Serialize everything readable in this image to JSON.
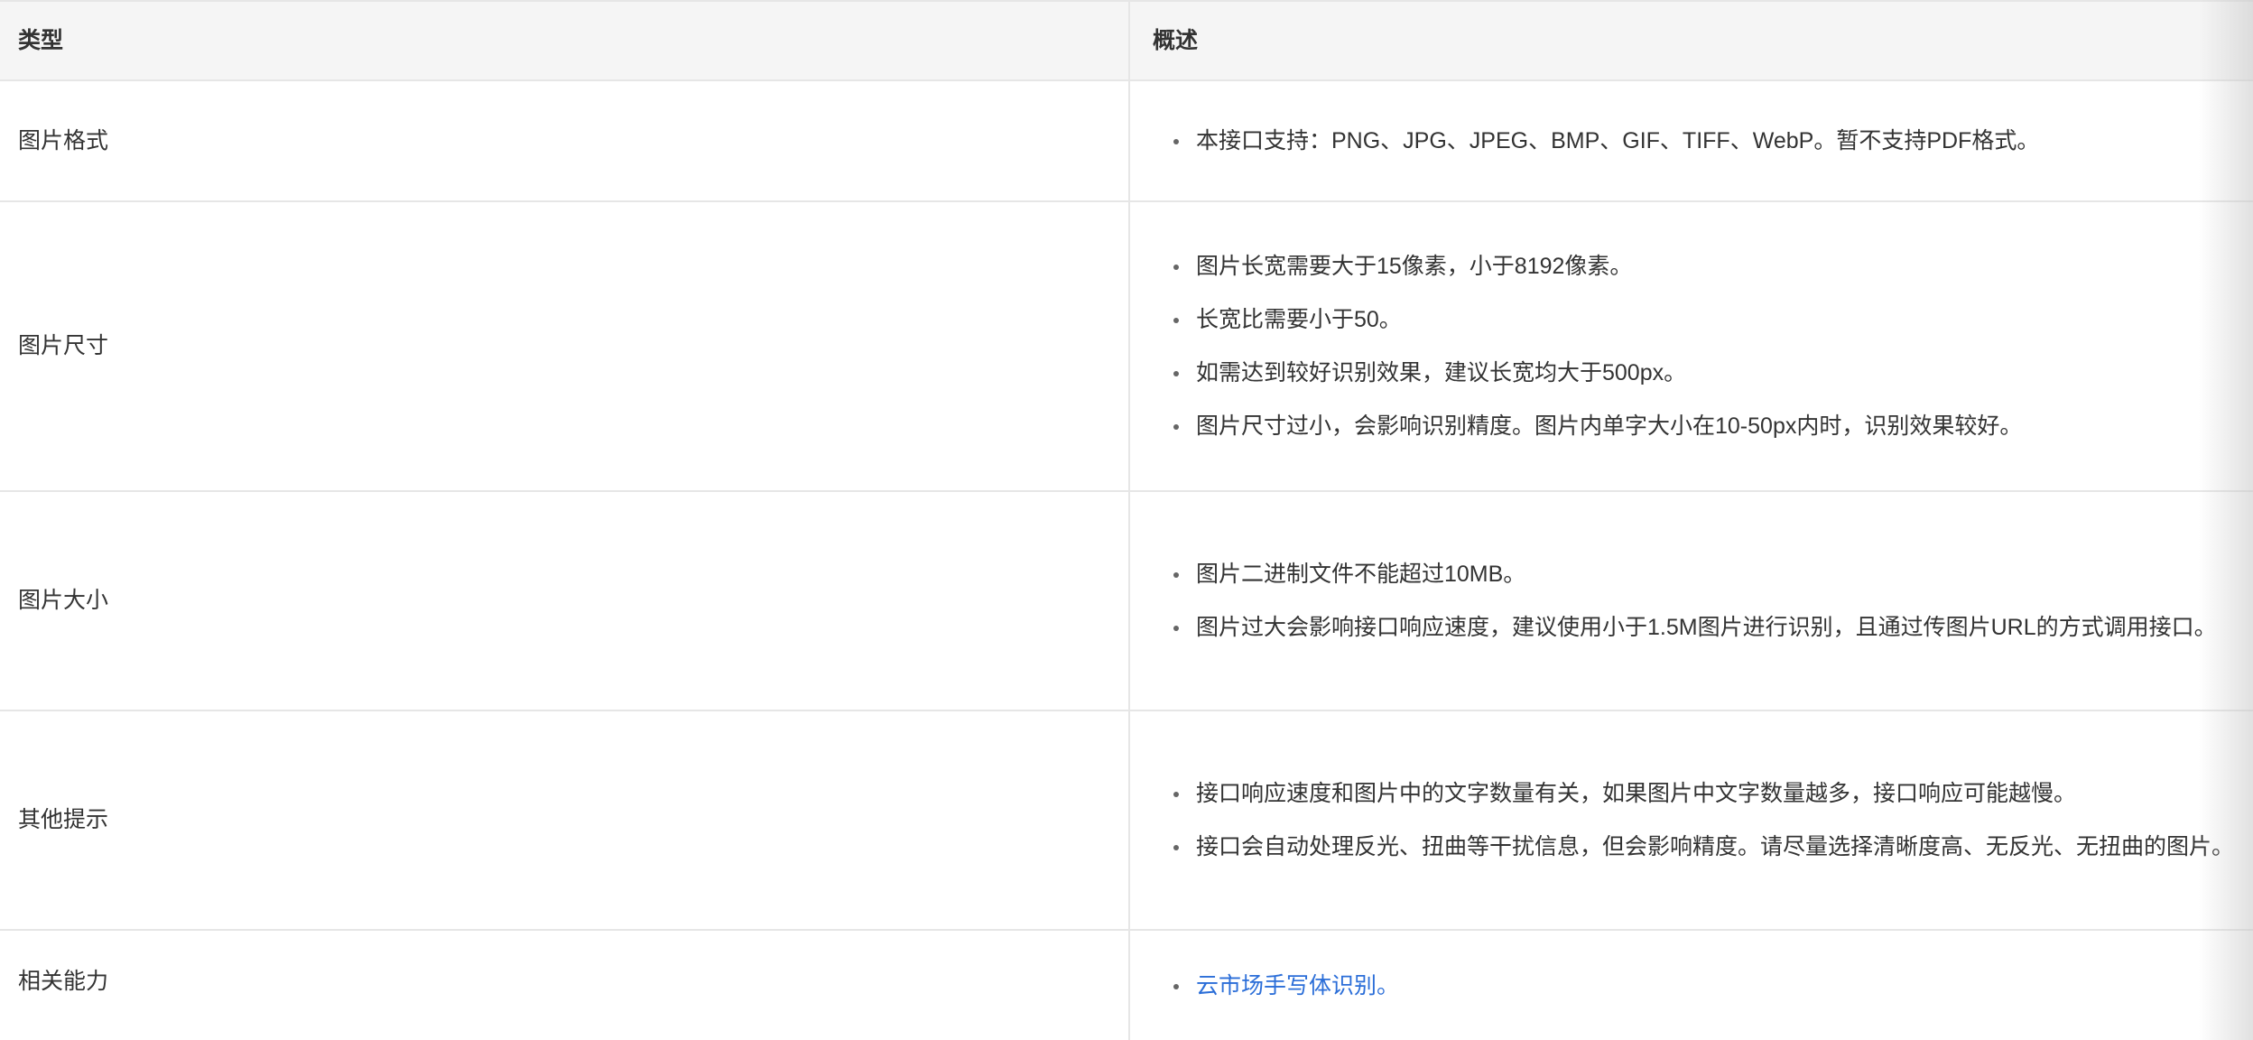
{
  "table": {
    "headers": [
      "类型",
      "概述"
    ],
    "rows": [
      {
        "type": "图片格式",
        "items": [
          "本接口支持：PNG、JPG、JPEG、BMP、GIF、TIFF、WebP。暂不支持PDF格式。"
        ]
      },
      {
        "type": "图片尺寸",
        "items": [
          "图片长宽需要大于15像素，小于8192像素。",
          "长宽比需要小于50。",
          "如需达到较好识别效果，建议长宽均大于500px。",
          "图片尺寸过小，会影响识别精度。图片内单字大小在10-50px内时，识别效果较好。"
        ]
      },
      {
        "type": "图片大小",
        "items": [
          "图片二进制文件不能超过10MB。",
          "图片过大会影响接口响应速度，建议使用小于1.5M图片进行识别，且通过传图片URL的方式调用接口。"
        ]
      },
      {
        "type": "其他提示",
        "items": [
          "接口响应速度和图片中的文字数量有关，如果图片中文字数量越多，接口响应可能越慢。",
          "接口会自动处理反光、扭曲等干扰信息，但会影响精度。请尽量选择清晰度高、无反光、无扭曲的图片。"
        ]
      },
      {
        "type": "相关能力",
        "link": "云市场手写体识别。"
      }
    ]
  },
  "colors": {
    "link": "#2b6ed8",
    "header_bg": "#f5f5f5",
    "border": "#e6e6e6"
  }
}
